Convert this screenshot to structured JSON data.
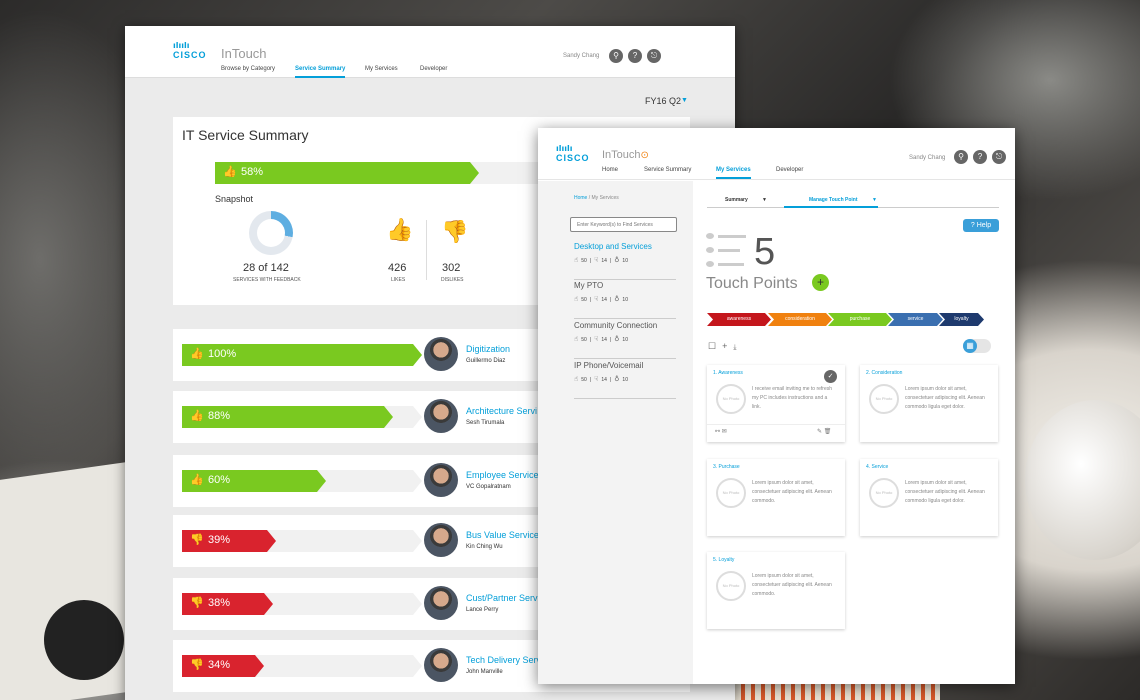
{
  "back": {
    "app_name": "InTouch",
    "logo_word": "CISCO",
    "nav": [
      "Browse by Category",
      "Service Summary",
      "My Services",
      "Developer"
    ],
    "user": "Sandy Chang",
    "quarter": "FY16 Q2",
    "summary": {
      "title": "IT Service Summary",
      "overall": "58%",
      "snapshot": "Snapshot",
      "feedback_count": "28 of 142",
      "feedback_label": "SERVICES WITH FEEDBACK",
      "likes": "426",
      "likes_label": "LIKES",
      "dislikes": "302",
      "dislikes_label": "DISLIKES"
    },
    "services": [
      {
        "pct": "100%",
        "name": "Digitization",
        "person": "Guillermo Diaz",
        "type": "like"
      },
      {
        "pct": "88%",
        "name": "Architecture Servi",
        "person": "Sesh Tirumala",
        "type": "like"
      },
      {
        "pct": "60%",
        "name": "Employee Service",
        "person": "VC Gopalratnam",
        "type": "like"
      },
      {
        "pct": "39%",
        "name": "Bus Value Service",
        "person": "Kin Ching Wu",
        "type": "dislike"
      },
      {
        "pct": "38%",
        "name": "Cust/Partner Serv",
        "person": "Lance Perry",
        "type": "dislike"
      },
      {
        "pct": "34%",
        "name": "Tech Delivery Serv",
        "person": "John Manville",
        "type": "dislike"
      }
    ],
    "overall_fraction": 0.58,
    "service_fractions": [
      1.0,
      0.88,
      0.6,
      0.39,
      0.38,
      0.34
    ]
  },
  "front": {
    "app_name": "InTouch",
    "logo_word": "CISCO",
    "nav": [
      "Home",
      "Service Summary",
      "My Services",
      "Developer"
    ],
    "user": "Sandy Chang",
    "crumb_home": "Home",
    "crumb_rest": " / My Services",
    "search_placeholder": "Enter Keyword(s) to Find Services",
    "services": [
      {
        "name": "Desktop and Services",
        "likes": "50",
        "dislikes": "14",
        "ideas": "10"
      },
      {
        "name": "My PTO",
        "likes": "50",
        "dislikes": "14",
        "ideas": "10"
      },
      {
        "name": "Community Connection",
        "likes": "50",
        "dislikes": "14",
        "ideas": "10"
      },
      {
        "name": "IP Phone/Voicemail",
        "likes": "50",
        "dislikes": "14",
        "ideas": "10"
      }
    ],
    "tab_summary": "Summary",
    "tab_manage": "Manage Touch Point",
    "help": "? Help",
    "tp_count": "5",
    "tp_label": "Touch Points",
    "steps": [
      {
        "label": "awareness",
        "color": "#c4161c"
      },
      {
        "label": "consideration",
        "color": "#f0810f"
      },
      {
        "label": "purchase",
        "color": "#7ac920"
      },
      {
        "label": "service",
        "color": "#3a6fb0"
      },
      {
        "label": "loyalty",
        "color": "#1e3a6e"
      }
    ],
    "cards": [
      {
        "title": "1. Awareness",
        "photo": "No Photo",
        "desc": "I receive email inviting me to refresh my PC includes instructions and a link."
      },
      {
        "title": "2. Consideration",
        "photo": "No Photo",
        "desc": "Lorem ipsum dolor sit amet, consectetuer adipiscing elit. Aenean commodo ligula eget dolor."
      },
      {
        "title": "3. Purchase",
        "photo": "No Photo",
        "desc": "Lorem ipsum dolor sit amet, consectetuer adipiscing elit. Aenean commodo."
      },
      {
        "title": "4. Service",
        "photo": "No Photo",
        "desc": "Lorem ipsum dolor sit amet, consectetuer adipiscing elit. Aenean commodo ligula eget dolor."
      },
      {
        "title": "5. Loyalty",
        "photo": "No Photo",
        "desc": "Lorem ipsum dolor sit amet, consectetuer adipiscing elit. Aenean commodo."
      }
    ]
  },
  "icons": {
    "thumb_up": "👍",
    "thumb_down": "👎"
  }
}
